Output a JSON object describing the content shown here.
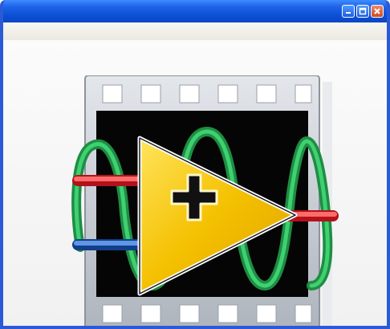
{
  "window": {
    "title": "",
    "controls": {
      "minimize": "minimize-icon",
      "maximize": "maximize-icon",
      "close": "close-icon"
    }
  },
  "logo": {
    "icon": "labview-add-function-icon",
    "glyph": "+"
  },
  "colors": {
    "titlebar": "#0b4fd6",
    "close_button": "#d24a1e",
    "film": "#c9ced6",
    "triangle": "#f4c000",
    "wave": "#2fb35a",
    "input_a": "#e4212b",
    "input_b": "#1d5fbf",
    "output": "#e4212b"
  }
}
